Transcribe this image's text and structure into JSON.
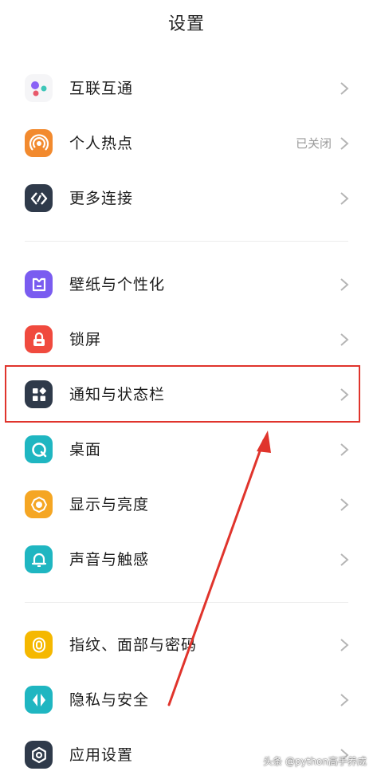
{
  "header": {
    "title": "设置"
  },
  "sections": [
    {
      "items": [
        {
          "label": "互联互通",
          "icon": "dots-icon",
          "value": ""
        },
        {
          "label": "个人热点",
          "icon": "hotspot-icon",
          "value": "已关闭"
        },
        {
          "label": "更多连接",
          "icon": "link-icon",
          "value": ""
        }
      ]
    },
    {
      "items": [
        {
          "label": "壁纸与个性化",
          "icon": "wallpaper-icon",
          "value": ""
        },
        {
          "label": "锁屏",
          "icon": "lock-icon",
          "value": ""
        },
        {
          "label": "通知与状态栏",
          "icon": "notification-icon",
          "value": ""
        },
        {
          "label": "桌面",
          "icon": "desktop-icon",
          "value": ""
        },
        {
          "label": "显示与亮度",
          "icon": "brightness-icon",
          "value": ""
        },
        {
          "label": "声音与触感",
          "icon": "bell-icon",
          "value": ""
        }
      ]
    },
    {
      "items": [
        {
          "label": "指纹、面部与密码",
          "icon": "fingerprint-icon",
          "value": ""
        },
        {
          "label": "隐私与安全",
          "icon": "privacy-icon",
          "value": ""
        },
        {
          "label": "应用设置",
          "icon": "app-settings-icon",
          "value": ""
        }
      ]
    }
  ],
  "watermark": "头条 @python高手养成",
  "colors": {
    "highlight": "#e0342c",
    "hotspot": "#f28a2e",
    "dark_icon": "#2f3a4a",
    "purple": "#7a5cf0",
    "red": "#f04a3e",
    "teal": "#1fb6c1",
    "orange": "#f5a623",
    "yellow": "#f5b800"
  }
}
